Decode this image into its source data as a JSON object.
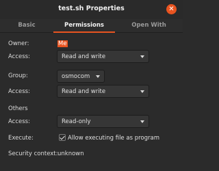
{
  "window": {
    "title": "test.sh Properties",
    "close_glyph": "✕"
  },
  "tabs": [
    {
      "label": "Basic"
    },
    {
      "label": "Permissions"
    },
    {
      "label": "Open With"
    }
  ],
  "permissions": {
    "owner": {
      "label": "Owner:",
      "value": "Me"
    },
    "owner_access": {
      "label": "Access:",
      "value": "Read and write"
    },
    "group": {
      "label": "Group:",
      "value": "osmocom"
    },
    "group_access": {
      "label": "Access:",
      "value": "Read and write"
    },
    "others_heading": "Others",
    "others_access": {
      "label": "Access:",
      "value": "Read-only"
    },
    "execute": {
      "label": "Execute:",
      "checkbox_label": "Allow executing file as program",
      "checked": true
    },
    "security_context": {
      "label": "Security context:",
      "value": "unknown"
    }
  },
  "colors": {
    "accent": "#e95420",
    "background": "#2b2b2b"
  }
}
